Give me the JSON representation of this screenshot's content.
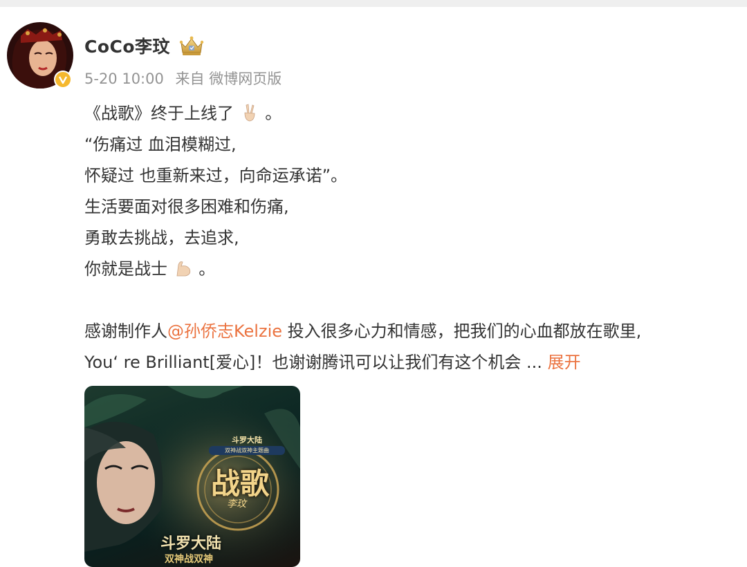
{
  "post": {
    "username": "CoCo李玟",
    "time": "5-20 10:00",
    "source": "来自 微博网页版",
    "lines": [
      "《战歌》终于上线了",
      "“伤痛过 血泪模糊过,",
      "怀疑过 也重新来过，向命运承诺”。",
      "生活要面对很多困难和伤痛,",
      "勇敢去挑战，去追求,",
      "你就是战士"
    ],
    "line1_end": "。",
    "line6_end": "。",
    "thanks_prefix": "感谢制作人",
    "mention": "@孙侨志Kelzie",
    "thanks_suffix": " 投入很多心力和情感，把我们的心血都放在歌里,",
    "line8": "You‘ re Brilliant[爱心]！也谢谢腾讯可以让我们有这个机会",
    "ellipsis": " ...",
    "expand_label": "展开"
  },
  "poster": {
    "badge_top": "斗罗大陆",
    "badge_sub": "双神战双神主题曲",
    "title": "战歌",
    "singer": "李玟",
    "series_logo": "斗罗大陆",
    "series_sub": "双神战双神"
  },
  "icons": {
    "verified": "verified-badge-icon",
    "crown": "crown-member-icon",
    "victory": "victory-hand-emoji-icon",
    "muscle": "flexed-biceps-emoji-icon"
  },
  "colors": {
    "link": "#eb7340",
    "text": "#333333",
    "meta": "#939393",
    "verified": "#f5b82e"
  }
}
